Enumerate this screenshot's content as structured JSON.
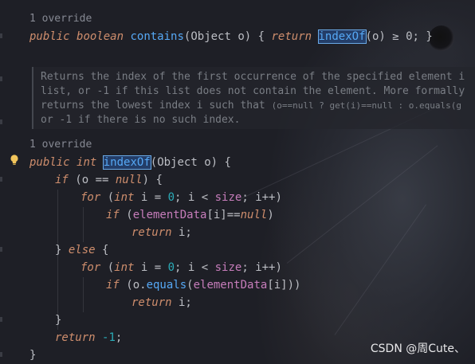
{
  "inlay_hints": {
    "override_1": "1 override",
    "override_2": "1 override"
  },
  "contains_line": {
    "kw_public": "public",
    "kw_boolean": "boolean",
    "name": "contains",
    "params": "(Object o) { ",
    "kw_return": "return",
    "call": "indexOf",
    "args": "(o) ≥ 0; }"
  },
  "javadoc": {
    "line1": "Returns the index of the first occurrence of the specified element i",
    "line2": "list, or -1 if this list does not contain the element. More formally",
    "line3_a": "returns the lowest index i such that ",
    "line3_b": "(o==null ? get(i)==null : o.equals(g",
    "line4": "or -1 if there is no such index."
  },
  "method": {
    "kw_public": "public",
    "kw_int": "int",
    "name": "indexOf",
    "params": "(Object o) {",
    "if1_kw": "if",
    "if1_rest_a": " (o ",
    "if1_op": "==",
    "if1_null": "null",
    "if1_rest_b": ") {",
    "for_kw": "for",
    "for_open": " (",
    "for_int": "int",
    "for_mid": " i = ",
    "for_zero": "0",
    "for_cond": "; i < ",
    "for_size": "size",
    "for_end": "; i++)",
    "if2_kw": "if",
    "if2_open": " (",
    "elementData": "elementData",
    "if2_idx": "[i]",
    "if2_op": "==",
    "if2_null": "null",
    "if2_close": ")",
    "ret_kw": "return",
    "ret_val": " i;",
    "else_open": "} ",
    "else_kw": "else",
    "else_brace": " {",
    "if3_o": " (o.",
    "equals": "equals",
    "if3_paren": "(",
    "if3_close": "[i]))",
    "close_brace": "}",
    "ret_minus": " -1;",
    "ret_num": "-1",
    "final_brace": "}"
  },
  "watermark": "CSDN @周Cute、",
  "colors": {
    "keyword": "#cf8e6d",
    "function": "#56a8f5",
    "field": "#c77dbb",
    "number": "#2aacb8",
    "comment": "#7a7e85"
  },
  "icons": {
    "intention": "lightbulb-icon"
  }
}
